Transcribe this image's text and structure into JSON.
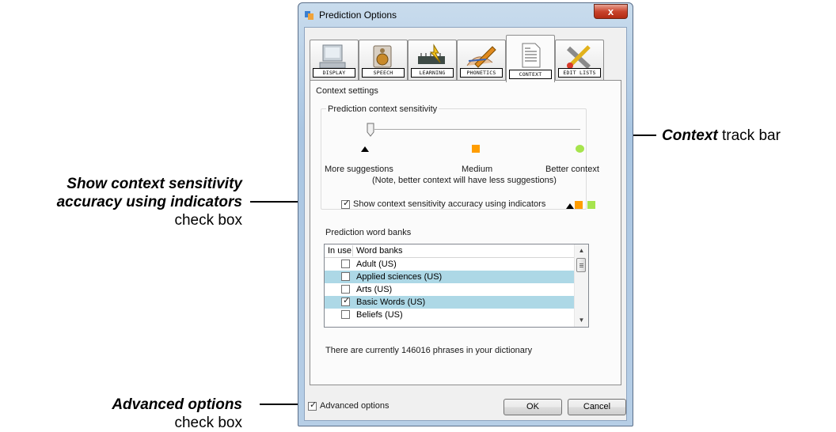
{
  "window": {
    "title": "Prediction Options",
    "close_glyph": "x",
    "tabs": [
      {
        "label": "DISPLAY",
        "icon": "monitor-icon"
      },
      {
        "label": "SPEECH",
        "icon": "speaker-icon"
      },
      {
        "label": "LEARNING",
        "icon": "brain-chip-icon"
      },
      {
        "label": "PHONETICS",
        "icon": "hand-pen-icon"
      },
      {
        "label": "CONTEXT",
        "icon": "document-icon",
        "active": true
      },
      {
        "label": "EDIT LISTS",
        "icon": "tools-icon"
      }
    ]
  },
  "context": {
    "group_label": "Context settings",
    "sensitivity_label": "Prediction context sensitivity",
    "track_value": 0,
    "track_min_label": "More suggestions",
    "track_mid_label": "Medium",
    "track_max_label": "Better context",
    "note": "(Note, better context will have less suggestions)",
    "show_indicators_label": "Show context sensitivity accuracy using indicators",
    "show_indicators_checked": true,
    "indicator_colors": {
      "low": "#000000",
      "medium": "#ff9d00",
      "high": "#a6e44d"
    }
  },
  "word_banks": {
    "label": "Prediction word banks",
    "columns": [
      "In use",
      "Word banks"
    ],
    "rows": [
      {
        "name": "Adult (US)",
        "in_use": false,
        "selected": false
      },
      {
        "name": "Applied sciences (US)",
        "in_use": false,
        "selected": true
      },
      {
        "name": "Arts (US)",
        "in_use": false,
        "selected": false
      },
      {
        "name": "Basic Words (US)",
        "in_use": true,
        "selected": true
      },
      {
        "name": "Beliefs (US)",
        "in_use": false,
        "selected": false
      }
    ],
    "status": "There are currently 146016 phrases in your dictionary"
  },
  "footer": {
    "advanced_label": "Advanced options",
    "advanced_checked": true,
    "ok_label": "OK",
    "cancel_label": "Cancel"
  },
  "callouts": {
    "trackbar": {
      "bold": "Context",
      "rest": " track bar"
    },
    "show_indicators": {
      "bold_line1": "Show context sensitivity",
      "bold_line2": "accuracy using indicators",
      "rest": "check box"
    },
    "advanced": {
      "bold": "Advanced options",
      "rest": "check box"
    }
  },
  "checkmark": "✓"
}
